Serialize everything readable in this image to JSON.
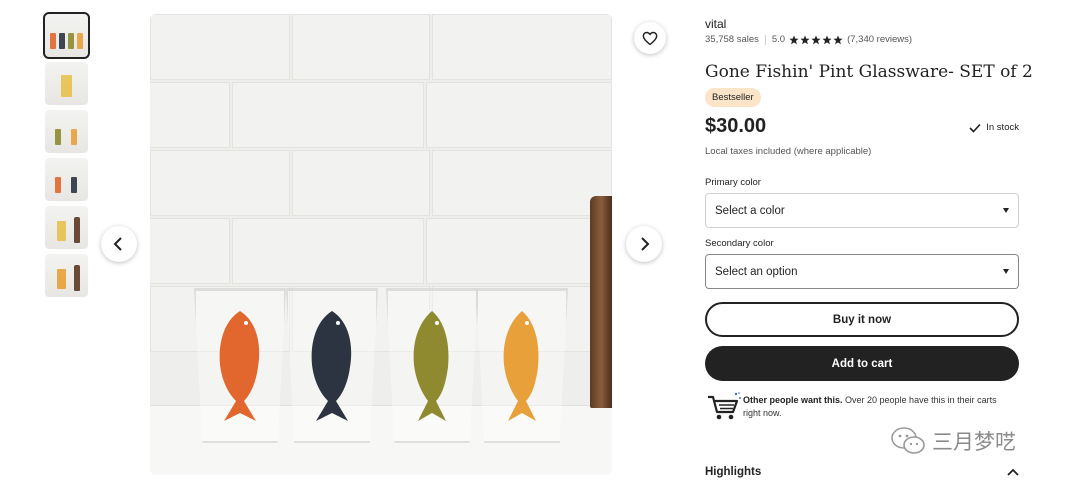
{
  "shop": {
    "name": "vital"
  },
  "stats": {
    "sales": "35,758 sales",
    "rating": "5.0",
    "reviews": "(7,340 reviews)"
  },
  "product": {
    "title": "Gone Fishin' Pint Glassware- SET of 2",
    "badge": "Bestseller",
    "price": "$30.00",
    "stock": "In stock",
    "tax_note": "Local taxes included (where applicable)"
  },
  "options": {
    "primary": {
      "label": "Primary color",
      "value": "Select a color"
    },
    "secondary": {
      "label": "Secondary color",
      "value": "Select an option"
    }
  },
  "actions": {
    "buy_now": "Buy it now",
    "add_to_cart": "Add to cart"
  },
  "notice": {
    "bold": "Other people want this.",
    "text": " Over 20 people have this in their carts right now."
  },
  "highlights": {
    "label": "Highlights"
  },
  "watermark": {
    "text": "三月梦呓"
  },
  "colors": {
    "fish": [
      "#e2672e",
      "#2b3440",
      "#8f8a2f",
      "#e8a03a"
    ],
    "badge_bg": "#fce4c8",
    "primary": "#222222"
  },
  "icons": [
    "heart-icon",
    "chevron-left-icon",
    "chevron-right-icon",
    "star-icon",
    "check-icon",
    "caret-down-icon",
    "cart-icon",
    "chevron-up-icon",
    "wechat-icon"
  ]
}
